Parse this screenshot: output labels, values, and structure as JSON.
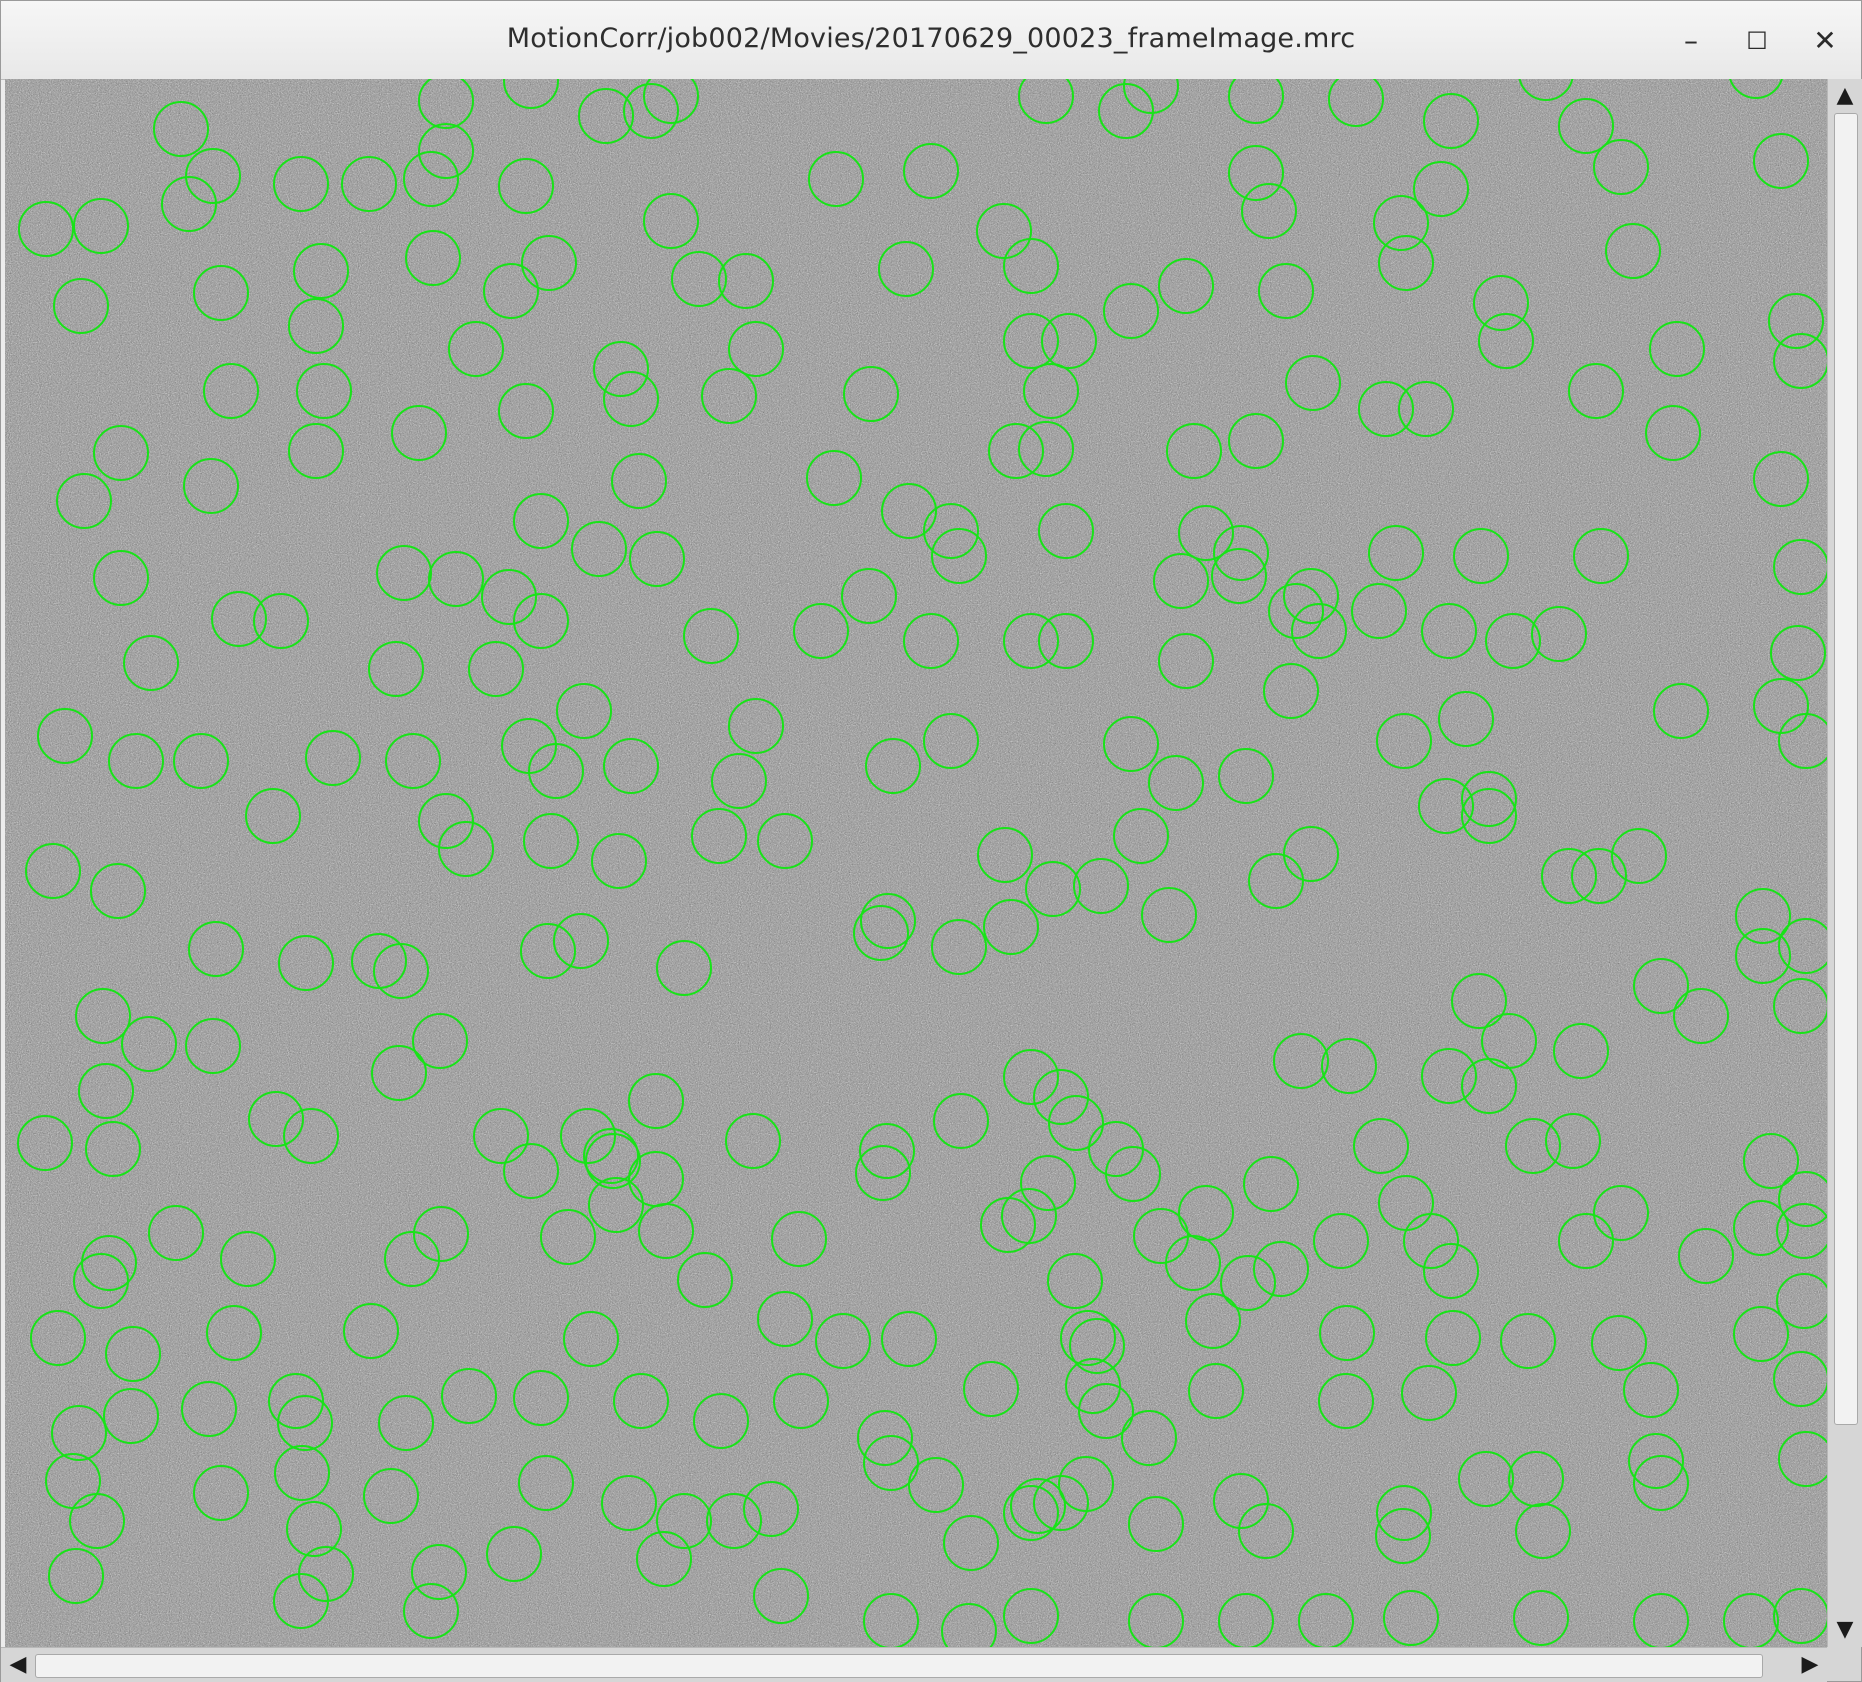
{
  "window": {
    "title": "MotionCorr/job002/Movies/20170629_00023_frameImage.mrc",
    "controls": {
      "minimize": "–",
      "maximize": "☐",
      "close": "✕"
    }
  },
  "image": {
    "kind": "cryo-EM micrograph",
    "marker_color": "#18e318",
    "marker_shape": "circle"
  },
  "scrollbars": {
    "up_arrow": "▲",
    "down_arrow": "▼",
    "left_arrow": "◀",
    "right_arrow": "▶"
  }
}
